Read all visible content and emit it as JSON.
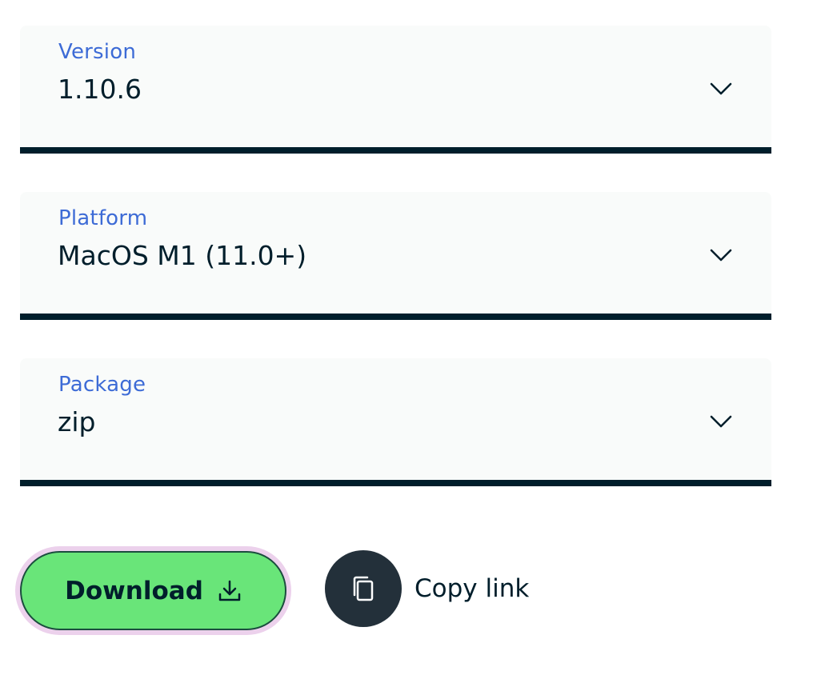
{
  "fields": {
    "version": {
      "label": "Version",
      "value": "1.10.6"
    },
    "platform": {
      "label": "Platform",
      "value": "MacOS M1 (11.0+)"
    },
    "package": {
      "label": "Package",
      "value": "zip"
    }
  },
  "actions": {
    "download_label": "Download",
    "copy_label": "Copy link"
  },
  "icons": {
    "select": "chevron-down-icon",
    "download": "download-icon",
    "copy": "copy-icon"
  },
  "colors": {
    "label_blue": "#3d6bd6",
    "field_bg": "#f9fbfa",
    "underline": "#001e2b",
    "download_green": "#69e579",
    "focus_ring": "#ecd1ec",
    "copy_circle": "#23303a"
  }
}
